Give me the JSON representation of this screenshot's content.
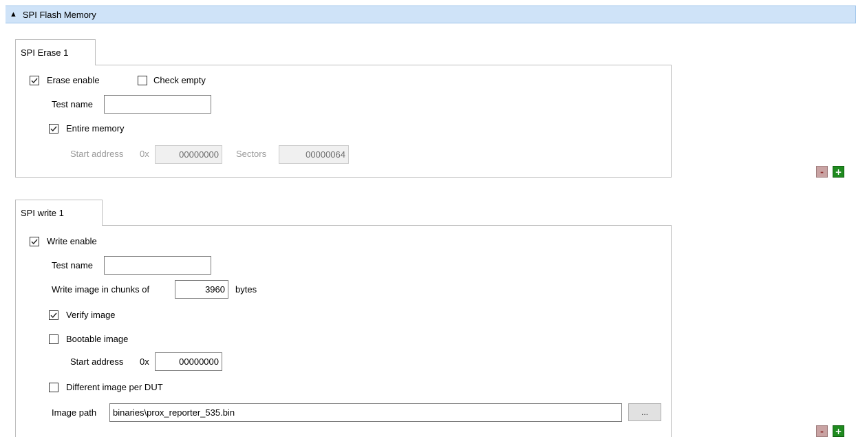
{
  "header": {
    "title": "SPI Flash Memory",
    "collapse_glyph": "▲"
  },
  "erase": {
    "tab_label": "SPI Erase 1",
    "erase_enable": {
      "label": "Erase enable",
      "checked": true
    },
    "check_empty": {
      "label": "Check empty",
      "checked": false
    },
    "test_name": {
      "label": "Test name",
      "value": ""
    },
    "entire_memory": {
      "label": "Entire memory",
      "checked": true
    },
    "start_address": {
      "label": "Start address",
      "prefix": "0x",
      "value": "00000000"
    },
    "sectors": {
      "label": "Sectors",
      "value": "00000064"
    }
  },
  "write": {
    "tab_label": "SPI write 1",
    "write_enable": {
      "label": "Write enable",
      "checked": true
    },
    "test_name": {
      "label": "Test name",
      "value": ""
    },
    "chunks": {
      "label": "Write image in chunks of",
      "value": "3960",
      "unit": "bytes"
    },
    "verify_image": {
      "label": "Verify image",
      "checked": true
    },
    "bootable_image": {
      "label": "Bootable image",
      "checked": false
    },
    "start_address": {
      "label": "Start address",
      "prefix": "0x",
      "value": "00000000"
    },
    "different_image": {
      "label": "Different image per DUT",
      "checked": false
    },
    "image_path": {
      "label": "Image path",
      "value": "binaries\\prox_reporter_535.bin",
      "browse_label": "..."
    }
  },
  "buttons": {
    "minus_label": "-",
    "plus_label": "+"
  },
  "colors": {
    "header_bg": "#cfe3f8",
    "plus_green": "#1f8a1f",
    "minus_red": "#c9a3a3"
  },
  "icons": {
    "checkmark": "checkmark-icon"
  }
}
